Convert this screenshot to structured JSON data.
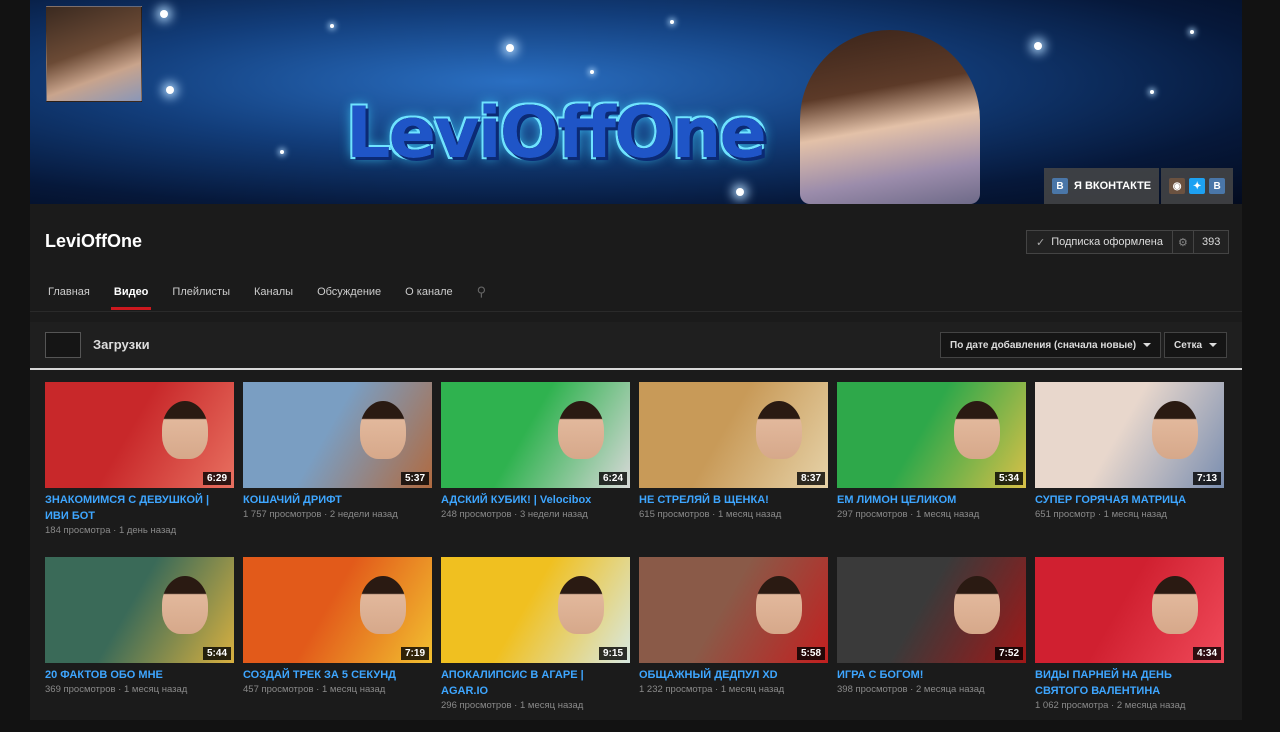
{
  "banner": {
    "logo_text": "LeviOffOne",
    "vk_link_label": "Я ВКОНТАКТЕ",
    "vk_glyph": "B",
    "social_icons": [
      "instagram-icon",
      "twitter-icon",
      "vk-icon"
    ]
  },
  "channel": {
    "name": "LeviOffOne",
    "subscribe_label": "Подписка оформлена",
    "subscriber_count": "393"
  },
  "tabs": [
    {
      "label": "Главная",
      "active": false
    },
    {
      "label": "Видео",
      "active": true
    },
    {
      "label": "Плейлисты",
      "active": false
    },
    {
      "label": "Каналы",
      "active": false
    },
    {
      "label": "Обсуждение",
      "active": false
    },
    {
      "label": "О канале",
      "active": false
    }
  ],
  "section": {
    "title": "Загрузки",
    "sort_label": "По дате добавления (сначала новые)",
    "view_label": "Сетка"
  },
  "videos": [
    {
      "title": "ЗНАКОМИМСЯ С ДЕВУШКОЙ | ИВИ БОТ",
      "duration": "6:29",
      "views": "184 просмотра",
      "age": "1 день назад",
      "colors": [
        "#c8282a",
        "#e87060"
      ]
    },
    {
      "title": "КОШАЧИЙ ДРИФТ",
      "duration": "5:37",
      "views": "1 757 просмотров",
      "age": "2 недели назад",
      "colors": [
        "#7a9ec2",
        "#b06a40"
      ]
    },
    {
      "title": "АДСКИЙ КУБИК! | Velocibox",
      "duration": "6:24",
      "views": "248 просмотров",
      "age": "3 недели назад",
      "colors": [
        "#2fb24f",
        "#d8d8d8"
      ]
    },
    {
      "title": "НЕ СТРЕЛЯЙ В ЩЕНКА!",
      "duration": "8:37",
      "views": "615 просмотров",
      "age": "1 месяц назад",
      "colors": [
        "#c89a58",
        "#e6d2a8"
      ]
    },
    {
      "title": "ЕМ ЛИМОН ЦЕЛИКОМ",
      "duration": "5:34",
      "views": "297 просмотров",
      "age": "1 месяц назад",
      "colors": [
        "#2ea84a",
        "#d8c048"
      ]
    },
    {
      "title": "СУПЕР ГОРЯЧАЯ МАТРИЦА",
      "duration": "7:13",
      "views": "651 просмотр",
      "age": "1 месяц назад",
      "colors": [
        "#e8d7cc",
        "#7a8eb0"
      ]
    },
    {
      "title": "20 ФАКТОВ ОБО МНЕ",
      "duration": "5:44",
      "views": "369 просмотров",
      "age": "1 месяц назад",
      "colors": [
        "#3a6a58",
        "#d8b040"
      ]
    },
    {
      "title": "СОЗДАЙ ТРЕК ЗА 5 СЕКУНД",
      "duration": "7:19",
      "views": "457 просмотров",
      "age": "1 месяц назад",
      "colors": [
        "#e25a1a",
        "#f2c030"
      ]
    },
    {
      "title": "АПОКАЛИПСИС В АГАРЕ | AGAR.IO",
      "duration": "9:15",
      "views": "296 просмотров",
      "age": "1 месяц назад",
      "colors": [
        "#f0c020",
        "#d8e8e0"
      ]
    },
    {
      "title": "ОБЩАЖНЫЙ ДЕДПУЛ XD",
      "duration": "5:58",
      "views": "1 232 просмотра",
      "age": "1 месяц назад",
      "colors": [
        "#8a5a48",
        "#c22020"
      ]
    },
    {
      "title": "ИГРА С БОГОМ!",
      "duration": "7:52",
      "views": "398 просмотров",
      "age": "2 месяца назад",
      "colors": [
        "#3a3a3a",
        "#a01818"
      ]
    },
    {
      "title": "ВИДЫ ПАРНЕЙ НА ДЕНЬ СВЯТОГО ВАЛЕНТИНА",
      "duration": "4:34",
      "views": "1 062 просмотра",
      "age": "2 месяца назад",
      "colors": [
        "#d02030",
        "#f04a5a"
      ]
    }
  ]
}
